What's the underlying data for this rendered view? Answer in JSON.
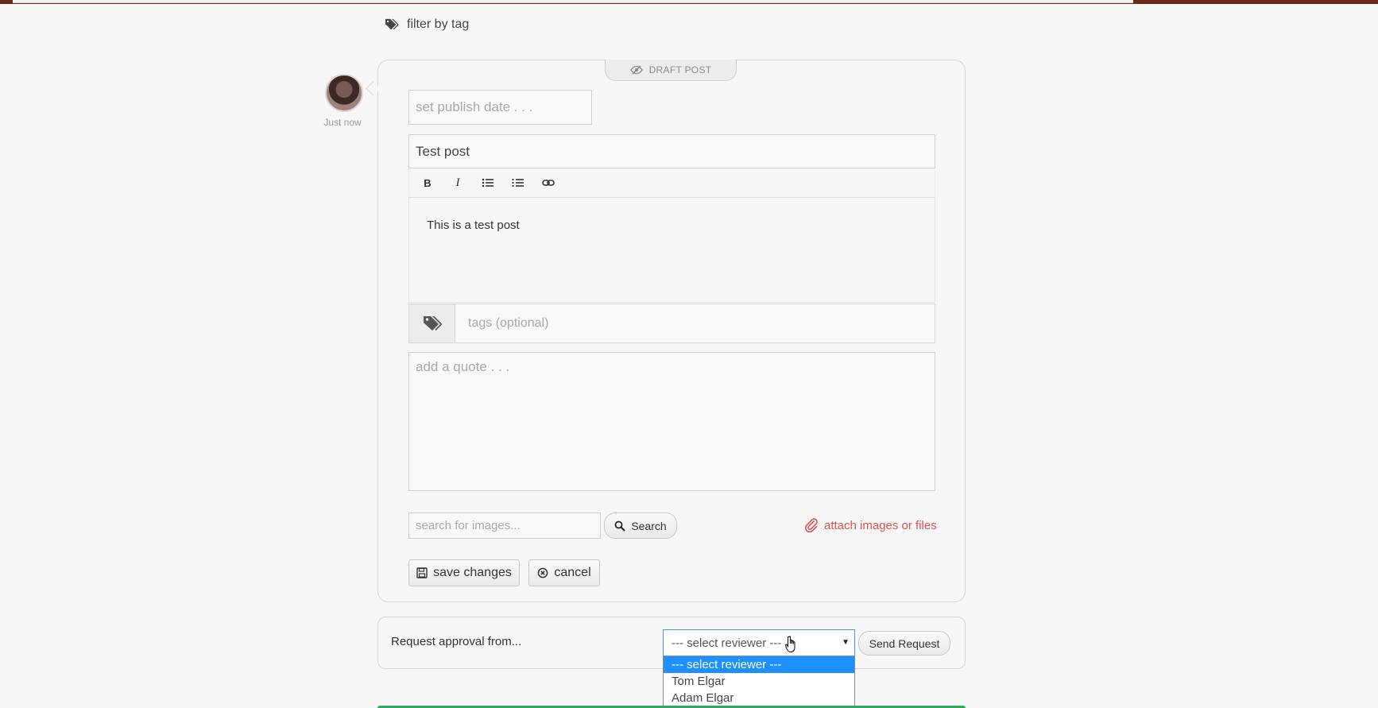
{
  "filter": {
    "label": "filter by tag",
    "icon": "tags-icon"
  },
  "post": {
    "timestamp": "Just now",
    "status_label": "DRAFT POST",
    "publish_placeholder": "set publish date . . .",
    "title_value": "Test post",
    "toolbar": [
      "bold",
      "italic",
      "bullet-list",
      "numbered-list",
      "link"
    ],
    "toolbar_bold": "B",
    "toolbar_italic": "I",
    "body": "This is a test post",
    "tags_placeholder": "tags (optional)",
    "quote_placeholder": "add a quote . . .",
    "image_search_placeholder": "search for images...",
    "search_label": "Search",
    "attach_label": "attach images or files",
    "save_label": "save changes",
    "cancel_label": "cancel"
  },
  "approval": {
    "label": "Request approval from...",
    "selected": "--- select reviewer ---",
    "options": [
      "--- select reviewer ---",
      "Tom Elgar",
      "Adam Elgar"
    ],
    "send_label": "Send Request"
  },
  "colors": {
    "accent_red": "#d9534f",
    "selection_blue": "#1e90ff",
    "success_green": "#2eaa5c"
  }
}
